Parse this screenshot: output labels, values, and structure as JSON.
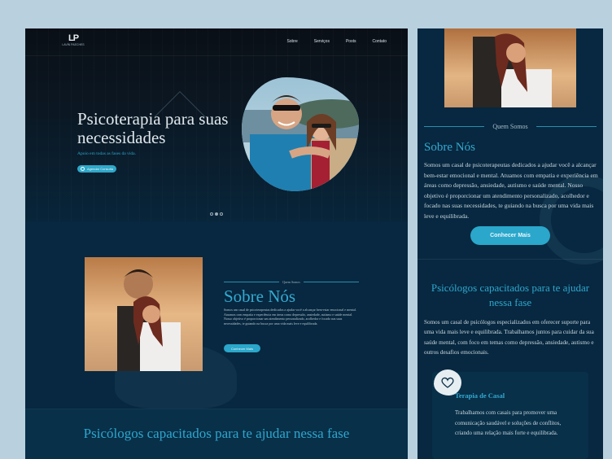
{
  "desktop": {
    "logo": {
      "mark": "LP",
      "text": "LAVÍN PAECHES"
    },
    "nav": [
      "Sobre",
      "Serviços",
      "Posts",
      "Contato"
    ],
    "hero": {
      "title": "Psicoterapia para suas necessidades",
      "subtitle": "Apoio em todas as fases da vida.",
      "button": "Agendar Consulta"
    },
    "about": {
      "eyebrow": "Quem Somos",
      "title": "Sobre Nós",
      "text": "Somos um casal de psicoterapeutas dedicados a ajudar você a alcançar bem-estar emocional e mental. Atuamos com empatia e experiência em áreas como depressão, ansiedade, autismo e saúde mental. Nosso objetivo é proporcionar um atendimento personalizado, acolhedor e focado nas suas necessidades, te guiando na busca por uma vida mais leve e equilibrada.",
      "button": "Conhecer Mais"
    },
    "services": {
      "title": "Psicólogos capacitados para te ajudar nessa fase"
    }
  },
  "mobile": {
    "about": {
      "eyebrow": "Quem Somos",
      "title": "Sobre Nós",
      "text": "Somos um casal de psicoterapeutas dedicados a ajudar você a alcançar bem-estar emocional e mental. Atuamos com empatia e experiência em áreas como depressão, ansiedade, autismo e saúde mental. Nosso objetivo é proporcionar um atendimento personalizado, acolhedor e focado nas suas necessidades, te guiando na busca por uma vida mais leve e equilibrada.",
      "button": "Conhecer Mais"
    },
    "services": {
      "title": "Psicólogos capacitados para te ajudar nessa fase",
      "text": "Somos um casal de psicólogos especializados em oferecer suporte para uma vida mais leve e equilibrada. Trabalhamos juntos para cuidar da sua saúde mental, com foco em temas como depressão, ansiedade, autismo e outros desafios emocionais.",
      "card": {
        "icon": "heart-icon",
        "title": "Terapia de Casal",
        "text": "Trabalhamos com casais para promover uma comunicação saudável e soluções de conflitos, criando uma relação mais forte e equilibrada."
      }
    }
  },
  "colors": {
    "background": "#b9d1df",
    "navy": "#072840",
    "accent": "#2aa7cb",
    "heading": "#34a9d0"
  }
}
